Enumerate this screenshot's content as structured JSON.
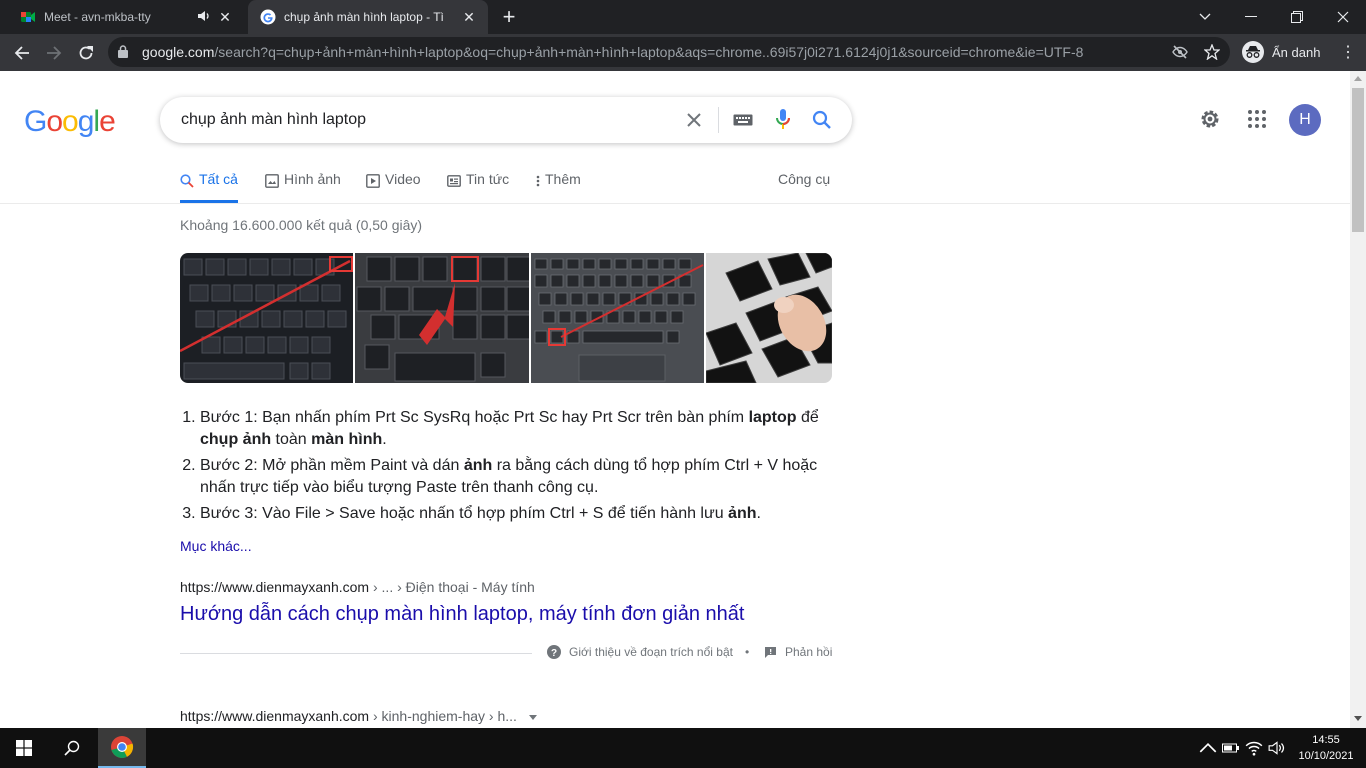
{
  "browser": {
    "tabs": [
      {
        "title": "Meet - avn-mkba-tty"
      },
      {
        "title": "chụp ảnh màn hình laptop - Tìm"
      }
    ],
    "url_host": "google.com",
    "url_rest": "/search?q=chụp+ảnh+màn+hình+laptop&oq=chụp+ảnh+màn+hình+laptop&aqs=chrome..69i57j0i271.6124j0j1&sourceid=chrome&ie=UTF-8",
    "incognito_label": "Ẩn danh"
  },
  "search": {
    "query": "chụp ảnh màn hình laptop",
    "tabs": [
      {
        "label": "Tất cả"
      },
      {
        "label": "Hình ảnh"
      },
      {
        "label": "Video"
      },
      {
        "label": "Tin tức"
      },
      {
        "label": "Thêm"
      }
    ],
    "tools_label": "Công cụ",
    "stats": "Khoảng 16.600.000 kết quả (0,50 giây)",
    "avatar_letter": "H"
  },
  "snippet": {
    "steps": [
      {
        "parts": [
          [
            "Bước 1: Bạn nhấn phím Prt Sc SysRq hoặc Prt Sc hay Prt Scr trên bàn phím ",
            false
          ],
          [
            "laptop",
            true
          ],
          [
            " để ",
            false
          ],
          [
            "chụp ảnh",
            true
          ],
          [
            " toàn ",
            false
          ],
          [
            "màn hình",
            true
          ],
          [
            ".",
            false
          ]
        ]
      },
      {
        "parts": [
          [
            "Bước 2: Mở phần mềm Paint và dán ",
            false
          ],
          [
            "ảnh",
            true
          ],
          [
            " ra bằng cách dùng tổ hợp phím Ctrl + V hoặc nhấn trực tiếp vào biểu tượng Paste trên thanh công cụ.",
            false
          ]
        ]
      },
      {
        "parts": [
          [
            "Bước 3: Vào File > Save hoặc nhấn tổ hợp phím Ctrl + S để tiến hành lưu ",
            false
          ],
          [
            "ảnh",
            true
          ],
          [
            ".",
            false
          ]
        ]
      }
    ],
    "more_label": "Mục khác...",
    "cite_host": "https://www.dienmayxanh.com",
    "cite_path": " › ... › Điện thoại - Máy tính",
    "result_title": "Hướng dẫn cách chụp màn hình laptop, máy tính đơn giản nhất",
    "about_label": "Giới thiệu về đoạn trích nổi bật",
    "feedback_label": "Phản hồi"
  },
  "result2": {
    "cite_host": "https://www.dienmayxanh.com",
    "cite_path": " › kinh-nghiem-hay › h..."
  },
  "taskbar": {
    "time": "14:55",
    "date": "10/10/2021"
  }
}
